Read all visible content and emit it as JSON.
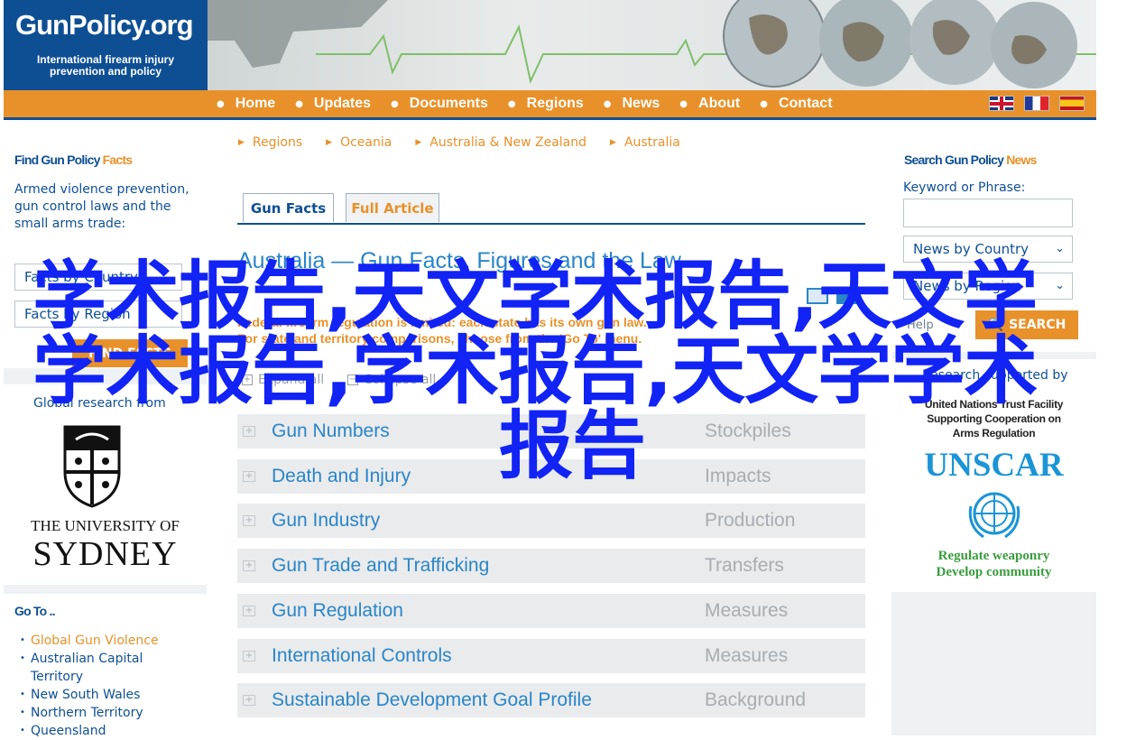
{
  "logo": {
    "title": "GunPolicy.org",
    "subtitle_line1": "International firearm injury",
    "subtitle_line2": "prevention and policy"
  },
  "nav": {
    "items": [
      "Home",
      "Updates",
      "Documents",
      "Regions",
      "News",
      "About",
      "Contact"
    ],
    "flags": [
      "uk-flag-icon",
      "france-flag-icon",
      "spain-flag-icon"
    ]
  },
  "left": {
    "find_heading_a": "Find Gun Policy ",
    "find_heading_b": "Facts",
    "find_text": "Armed violence prevention, gun control laws and the small arms trade:",
    "select1": "Facts by Country",
    "select2": "Facts by Region",
    "find_button": "FIND FACTS",
    "global_research": "Global research from",
    "university_line1": "THE UNIVERSITY OF",
    "university_line2": "SYDNEY",
    "goto_heading": "Go To ..",
    "goto_items": [
      "Global Gun Violence",
      "Australian Capital Territory",
      "New South Wales",
      "Northern Territory",
      "Queensland"
    ]
  },
  "center": {
    "breadcrumbs": [
      "Regions",
      "Oceania",
      "Australia & New Zealand",
      "Australia"
    ],
    "tab_facts": "Gun Facts",
    "tab_article": "Full Article",
    "title": "Australia — Gun Facts, Figures and the Law",
    "lead_line1": "Federal firearm regulation is limited: each state has its own gun law.",
    "lead_line2": "For state and territory comparisons, choose from the 'Go To' menu.",
    "expand_all": "Expand all",
    "collapse_all": "Collapse all",
    "rows": [
      {
        "name": "Gun Numbers",
        "category": "Stockpiles"
      },
      {
        "name": "Death and Injury",
        "category": "Impacts"
      },
      {
        "name": "Gun Industry",
        "category": "Production"
      },
      {
        "name": "Gun Trade and Trafficking",
        "category": "Transfers"
      },
      {
        "name": "Gun Regulation",
        "category": "Measures"
      },
      {
        "name": "International Controls",
        "category": "Measures"
      },
      {
        "name": "Sustainable Development Goal Profile",
        "category": "Background"
      }
    ]
  },
  "right": {
    "search_heading_a": "Search Gun Policy ",
    "search_heading_b": "News",
    "keyword_label": "Keyword or Phrase:",
    "keyword_value": "",
    "select1": "News by Country",
    "select2": "News by Region",
    "help": "Help",
    "search_button": "SEARCH",
    "supported_by": "Research supported by",
    "un_line1": "United Nations Trust Facility",
    "un_line2": "Supporting Cooperation on",
    "un_line3": "Arms Regulation",
    "unscar": "UNSCAR",
    "slogan1": "Regulate weaponry",
    "slogan2": "Develop community"
  },
  "watermark": {
    "line1": "学术报告,天文学术报告,天文学",
    "line2": "学术报告,学术报告,天文学学术",
    "line3": "报告"
  },
  "colors": {
    "brand_blue": "#0e4f94",
    "accent_orange": "#e8912a",
    "link_blue": "#2a85c8",
    "watermark": "#1123f5"
  }
}
